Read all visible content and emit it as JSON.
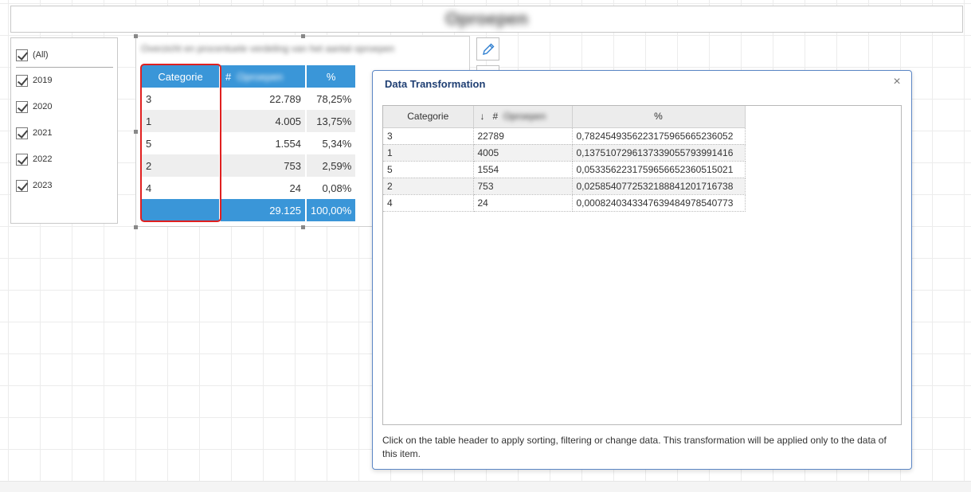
{
  "page": {
    "title": "Oproepen"
  },
  "filter": {
    "items": [
      {
        "label": "(All)",
        "checked": true
      },
      {
        "label": "2019",
        "checked": true
      },
      {
        "label": "2020",
        "checked": true
      },
      {
        "label": "2021",
        "checked": true
      },
      {
        "label": "2022",
        "checked": true
      },
      {
        "label": "2023",
        "checked": true
      }
    ]
  },
  "grid": {
    "caption": "Overzicht en procentuele verdeling van het aantal oproepen",
    "headers": {
      "category": "Categorie",
      "count_symbol": "#",
      "count_word": "Oproepen",
      "percent": "%"
    },
    "rows": [
      {
        "category": "3",
        "count": "22.789",
        "percent": "78,25%"
      },
      {
        "category": "1",
        "count": "4.005",
        "percent": "13,75%"
      },
      {
        "category": "5",
        "count": "1.554",
        "percent": "5,34%"
      },
      {
        "category": "2",
        "count": "753",
        "percent": "2,59%"
      },
      {
        "category": "4",
        "count": "24",
        "percent": "0,08%"
      }
    ],
    "total": {
      "category": "",
      "count": "29.125",
      "percent": "100,00%"
    }
  },
  "tools": {
    "edit_icon": "pencil-icon"
  },
  "dialog": {
    "title": "Data Transformation",
    "close_label": "×",
    "headers": {
      "category": "Categorie",
      "sort_arrow": "↓",
      "count_symbol": "#",
      "count_word": "Oproepen",
      "percent": "%"
    },
    "rows": [
      {
        "category": "3",
        "count": "22789",
        "percent": "0,78245493562231759656652360 52"
      },
      {
        "category": "1",
        "count": "4005",
        "percent": "0,13751072961373390557939914 16"
      },
      {
        "category": "5",
        "count": "1554",
        "percent": "0,05335622317596566523605150 21"
      },
      {
        "category": "2",
        "count": "753",
        "percent": "0,02585407725321888412017167 38"
      },
      {
        "category": "4",
        "count": "24",
        "percent": "0,00082403433476394849785407 73"
      }
    ],
    "footer": "Click on the table header to apply sorting, filtering or change data. This transformation will be applied only to the data of this item."
  },
  "colors": {
    "accent": "#3a96d8",
    "highlight": "#e02020",
    "dialog_border": "#5b86c5",
    "dialog_title": "#1f3f73"
  }
}
